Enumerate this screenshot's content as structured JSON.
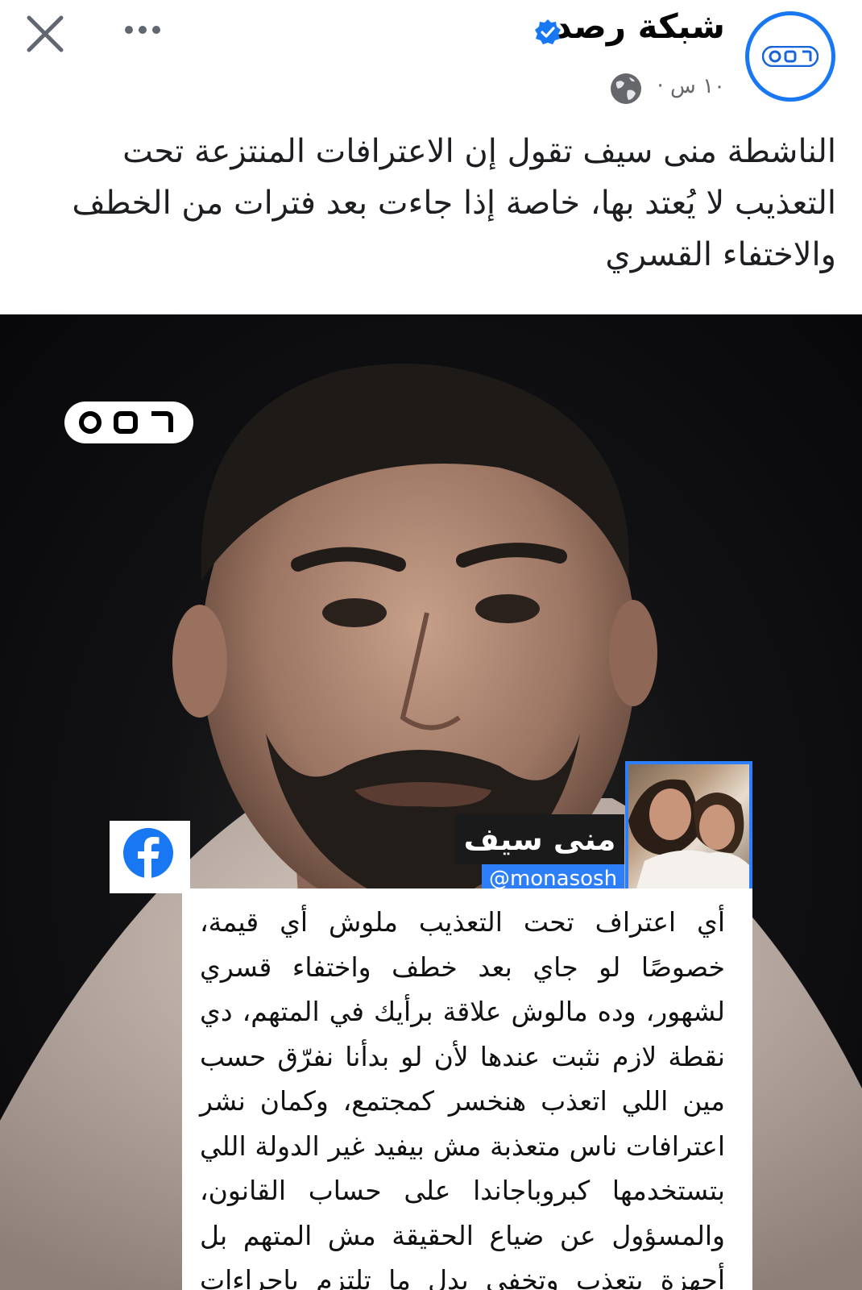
{
  "post": {
    "page_name": "شبكة رصد",
    "time": "١٠ س ·",
    "caption": "الناشطة منى سيف تقول إن الاعترافات المنتزعة تحت التعذيب لا يُعتد بها، خاصة إذا جاءت بعد فترات من الخطف والاختفاء القسري",
    "icons": [
      "close-icon",
      "more-icon",
      "verified-badge-icon",
      "globe-icon"
    ],
    "accent_color": "#1877f2"
  },
  "media": {
    "logo_text": "رصد",
    "quote_author": "منى سيف",
    "quote_handle": "@monasosh",
    "quote_text": "أي اعتراف تحت التعذيب ملوش أي قيمة، خصوصًا لو جاي بعد خطف واختفاء قسري لشهور، وده مالوش علاقة برأيك في المتهم، دي نقطة لازم نثبت عندها لأن لو بدأنا نفرّق حسب مين اللي اتعذب هنخسر كمجتمع، وكمان نشر اعترافات ناس متعذبة مش بيفيد غير الدولة اللي بتستخدمها كبروباجاندا على حساب القانون، والمسؤول عن ضياع الحقيقة مش المتهم بل أجهزة بتعذب وتخفي بدل ما تلتزم بإجراءات عدالة سليمة.",
    "source_icon": "facebook-icon"
  }
}
